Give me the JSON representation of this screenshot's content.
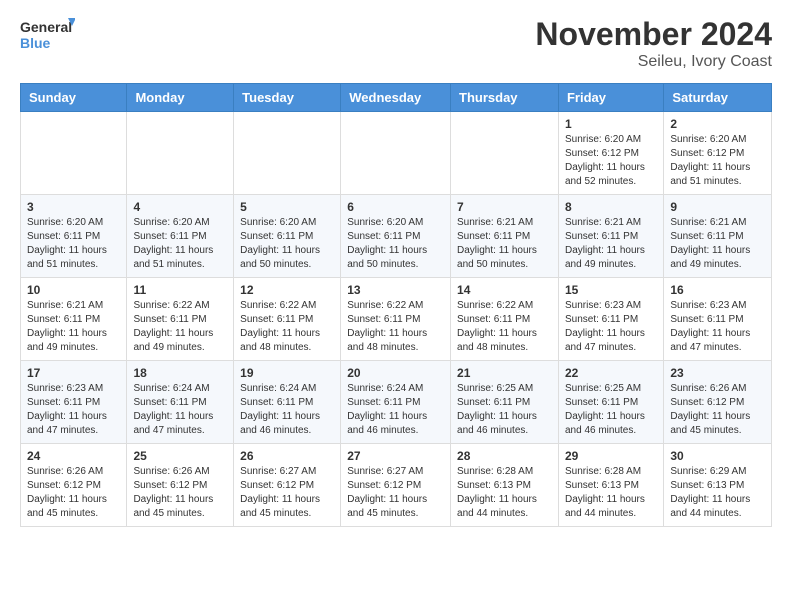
{
  "header": {
    "logo_general": "General",
    "logo_blue": "Blue",
    "title": "November 2024",
    "subtitle": "Seileu, Ivory Coast"
  },
  "calendar": {
    "headers": [
      "Sunday",
      "Monday",
      "Tuesday",
      "Wednesday",
      "Thursday",
      "Friday",
      "Saturday"
    ],
    "weeks": [
      {
        "days": [
          {
            "day": "",
            "info": ""
          },
          {
            "day": "",
            "info": ""
          },
          {
            "day": "",
            "info": ""
          },
          {
            "day": "",
            "info": ""
          },
          {
            "day": "",
            "info": ""
          },
          {
            "day": "1",
            "info": "Sunrise: 6:20 AM\nSunset: 6:12 PM\nDaylight: 11 hours and 52 minutes."
          },
          {
            "day": "2",
            "info": "Sunrise: 6:20 AM\nSunset: 6:12 PM\nDaylight: 11 hours and 51 minutes."
          }
        ]
      },
      {
        "days": [
          {
            "day": "3",
            "info": "Sunrise: 6:20 AM\nSunset: 6:11 PM\nDaylight: 11 hours and 51 minutes."
          },
          {
            "day": "4",
            "info": "Sunrise: 6:20 AM\nSunset: 6:11 PM\nDaylight: 11 hours and 51 minutes."
          },
          {
            "day": "5",
            "info": "Sunrise: 6:20 AM\nSunset: 6:11 PM\nDaylight: 11 hours and 50 minutes."
          },
          {
            "day": "6",
            "info": "Sunrise: 6:20 AM\nSunset: 6:11 PM\nDaylight: 11 hours and 50 minutes."
          },
          {
            "day": "7",
            "info": "Sunrise: 6:21 AM\nSunset: 6:11 PM\nDaylight: 11 hours and 50 minutes."
          },
          {
            "day": "8",
            "info": "Sunrise: 6:21 AM\nSunset: 6:11 PM\nDaylight: 11 hours and 49 minutes."
          },
          {
            "day": "9",
            "info": "Sunrise: 6:21 AM\nSunset: 6:11 PM\nDaylight: 11 hours and 49 minutes."
          }
        ]
      },
      {
        "days": [
          {
            "day": "10",
            "info": "Sunrise: 6:21 AM\nSunset: 6:11 PM\nDaylight: 11 hours and 49 minutes."
          },
          {
            "day": "11",
            "info": "Sunrise: 6:22 AM\nSunset: 6:11 PM\nDaylight: 11 hours and 49 minutes."
          },
          {
            "day": "12",
            "info": "Sunrise: 6:22 AM\nSunset: 6:11 PM\nDaylight: 11 hours and 48 minutes."
          },
          {
            "day": "13",
            "info": "Sunrise: 6:22 AM\nSunset: 6:11 PM\nDaylight: 11 hours and 48 minutes."
          },
          {
            "day": "14",
            "info": "Sunrise: 6:22 AM\nSunset: 6:11 PM\nDaylight: 11 hours and 48 minutes."
          },
          {
            "day": "15",
            "info": "Sunrise: 6:23 AM\nSunset: 6:11 PM\nDaylight: 11 hours and 47 minutes."
          },
          {
            "day": "16",
            "info": "Sunrise: 6:23 AM\nSunset: 6:11 PM\nDaylight: 11 hours and 47 minutes."
          }
        ]
      },
      {
        "days": [
          {
            "day": "17",
            "info": "Sunrise: 6:23 AM\nSunset: 6:11 PM\nDaylight: 11 hours and 47 minutes."
          },
          {
            "day": "18",
            "info": "Sunrise: 6:24 AM\nSunset: 6:11 PM\nDaylight: 11 hours and 47 minutes."
          },
          {
            "day": "19",
            "info": "Sunrise: 6:24 AM\nSunset: 6:11 PM\nDaylight: 11 hours and 46 minutes."
          },
          {
            "day": "20",
            "info": "Sunrise: 6:24 AM\nSunset: 6:11 PM\nDaylight: 11 hours and 46 minutes."
          },
          {
            "day": "21",
            "info": "Sunrise: 6:25 AM\nSunset: 6:11 PM\nDaylight: 11 hours and 46 minutes."
          },
          {
            "day": "22",
            "info": "Sunrise: 6:25 AM\nSunset: 6:11 PM\nDaylight: 11 hours and 46 minutes."
          },
          {
            "day": "23",
            "info": "Sunrise: 6:26 AM\nSunset: 6:12 PM\nDaylight: 11 hours and 45 minutes."
          }
        ]
      },
      {
        "days": [
          {
            "day": "24",
            "info": "Sunrise: 6:26 AM\nSunset: 6:12 PM\nDaylight: 11 hours and 45 minutes."
          },
          {
            "day": "25",
            "info": "Sunrise: 6:26 AM\nSunset: 6:12 PM\nDaylight: 11 hours and 45 minutes."
          },
          {
            "day": "26",
            "info": "Sunrise: 6:27 AM\nSunset: 6:12 PM\nDaylight: 11 hours and 45 minutes."
          },
          {
            "day": "27",
            "info": "Sunrise: 6:27 AM\nSunset: 6:12 PM\nDaylight: 11 hours and 45 minutes."
          },
          {
            "day": "28",
            "info": "Sunrise: 6:28 AM\nSunset: 6:13 PM\nDaylight: 11 hours and 44 minutes."
          },
          {
            "day": "29",
            "info": "Sunrise: 6:28 AM\nSunset: 6:13 PM\nDaylight: 11 hours and 44 minutes."
          },
          {
            "day": "30",
            "info": "Sunrise: 6:29 AM\nSunset: 6:13 PM\nDaylight: 11 hours and 44 minutes."
          }
        ]
      }
    ]
  }
}
